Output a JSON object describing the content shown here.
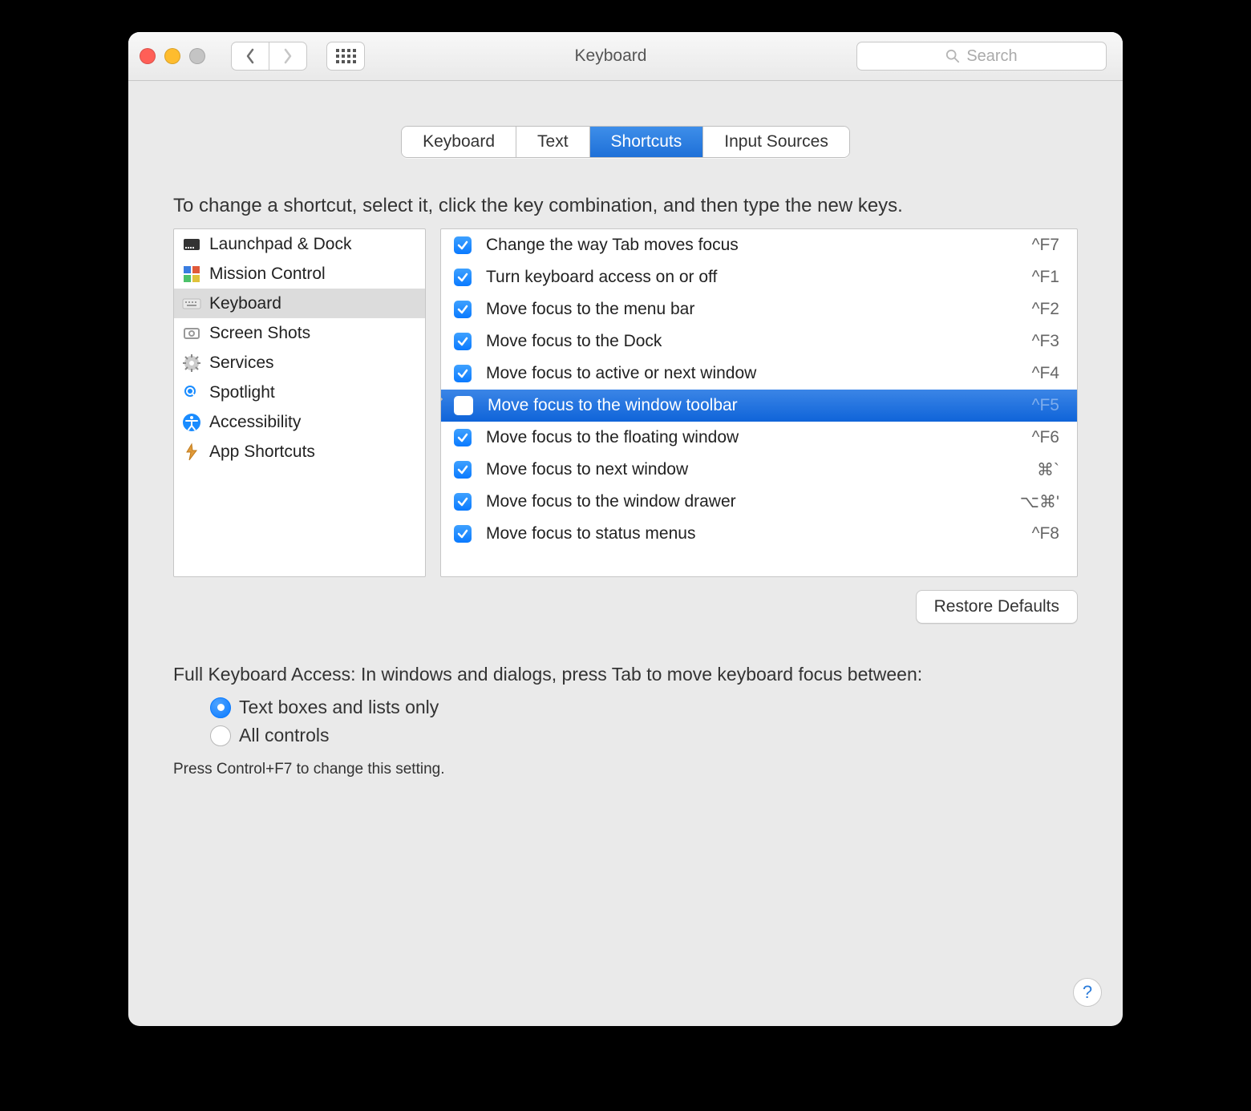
{
  "window": {
    "title": "Keyboard"
  },
  "toolbar": {
    "search_placeholder": "Search"
  },
  "tabs": [
    "Keyboard",
    "Text",
    "Shortcuts",
    "Input Sources"
  ],
  "active_tab_index": 2,
  "instructions": "To change a shortcut, select it, click the key combination, and then type the new keys.",
  "categories": [
    {
      "label": "Launchpad & Dock",
      "icon": "launchpad"
    },
    {
      "label": "Mission Control",
      "icon": "mission-control"
    },
    {
      "label": "Keyboard",
      "icon": "keyboard",
      "selected": true
    },
    {
      "label": "Screen Shots",
      "icon": "screenshot"
    },
    {
      "label": "Services",
      "icon": "gear"
    },
    {
      "label": "Spotlight",
      "icon": "spotlight"
    },
    {
      "label": "Accessibility",
      "icon": "accessibility"
    },
    {
      "label": "App Shortcuts",
      "icon": "appshortcuts"
    }
  ],
  "shortcuts": [
    {
      "checked": true,
      "label": "Change the way Tab moves focus",
      "keys": "^F7"
    },
    {
      "checked": true,
      "label": "Turn keyboard access on or off",
      "keys": "^F1"
    },
    {
      "checked": true,
      "label": "Move focus to the menu bar",
      "keys": "^F2"
    },
    {
      "checked": true,
      "label": "Move focus to the Dock",
      "keys": "^F3"
    },
    {
      "checked": true,
      "label": "Move focus to active or next window",
      "keys": "^F4"
    },
    {
      "checked": false,
      "label": "Move focus to the window toolbar",
      "keys": "^F5",
      "selected": true
    },
    {
      "checked": true,
      "label": "Move focus to the floating window",
      "keys": "^F6"
    },
    {
      "checked": true,
      "label": "Move focus to next window",
      "keys": "⌘`"
    },
    {
      "checked": true,
      "label": "Move focus to the window drawer",
      "keys": "⌥⌘'"
    },
    {
      "checked": true,
      "label": "Move focus to status menus",
      "keys": "^F8"
    }
  ],
  "restore_button": "Restore Defaults",
  "fka_heading": "Full Keyboard Access: In windows and dialogs, press Tab to move keyboard focus between:",
  "fka_options": [
    {
      "label": "Text boxes and lists only",
      "checked": true
    },
    {
      "label": "All controls",
      "checked": false
    }
  ],
  "fka_hint": "Press Control+F7 to change this setting.",
  "help_label": "?"
}
